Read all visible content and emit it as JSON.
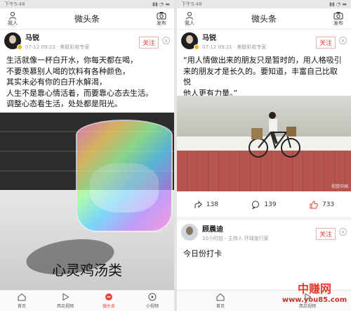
{
  "status_time": "下午5:48",
  "app": {
    "title": "微头条",
    "left_label": "我人",
    "right_label": "发布"
  },
  "left_post": {
    "author": "马锐",
    "meta": "07-12 09:23 · 美联彩收专家",
    "follow_label": "关注",
    "text_lines": [
      "生活就像一杯白开水，你每天都在喝，",
      "不要羡慕别人喝的饮料有各种颜色，",
      "其实未必有你的白开水解渴，",
      "人生不是靠心情活着，而要靠心态去生活。",
      "调整心态看生活，处处都是阳光。"
    ],
    "image_caption": "心灵鸡汤类"
  },
  "right_post": {
    "author": "马锐",
    "meta": "07-12 09:21 · 美联彩收专家",
    "follow_label": "关注",
    "text_lines": [
      "“用人情做出来的朋友只是暂时的，用人格吸引",
      "来的朋友才是长久的。要知道，丰富自己比取悦",
      "他人更有力量。”"
    ],
    "image_credit": "视觉中国",
    "actions": {
      "shares": "138",
      "comments": "139",
      "likes": "733"
    }
  },
  "next_post": {
    "author": "顾晨迪",
    "meta": "10小时前 · 主持人 环球旅行家",
    "follow_label": "关注",
    "text": "今日份打卡"
  },
  "tabs": [
    {
      "label": "首页",
      "icon": "home-icon"
    },
    {
      "label": "西瓜视频",
      "icon": "play-icon"
    },
    {
      "label": "微头条",
      "icon": "microhead-icon"
    },
    {
      "label": "小视频",
      "icon": "video-icon"
    }
  ],
  "watermark": {
    "brand": "中赚网",
    "url": "www.you85.com"
  },
  "colors": {
    "accent": "#e8433c",
    "watermark_red": "#e63a2e",
    "badge": "#f2b50f"
  }
}
